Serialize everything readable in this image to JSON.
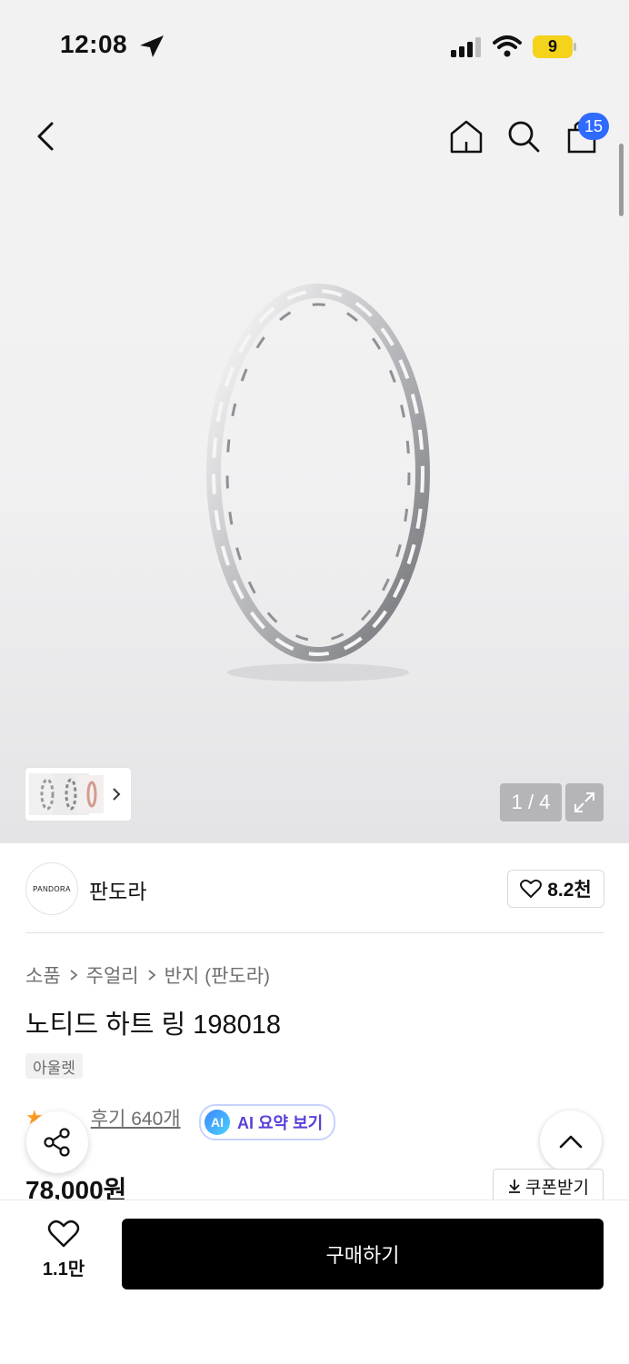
{
  "status_bar": {
    "time": "12:08",
    "battery": "9"
  },
  "header": {
    "cart_count": "15"
  },
  "gallery": {
    "counter": "1 / 4"
  },
  "brand": {
    "logo_text": "PANDORA",
    "name": "판도라",
    "likes": "8.2천"
  },
  "breadcrumbs": [
    "소품",
    "주얼리",
    "반지 (판도라)"
  ],
  "product": {
    "title": "노티드 하트 링 198018",
    "tag": "아울렛",
    "review_link": "후기 640개",
    "ai_summary": "AI 요약 보기",
    "ai_badge": "AI",
    "price": "78,000원",
    "coupon": "쿠폰받기"
  },
  "bottom_bar": {
    "wish_count": "1.1만",
    "buy_label": "구매하기"
  },
  "colors": {
    "accent_blue": "#2f6bff",
    "ai_purple": "#5a3fd6",
    "star": "#ff9b20",
    "buy_bg": "#000000"
  }
}
